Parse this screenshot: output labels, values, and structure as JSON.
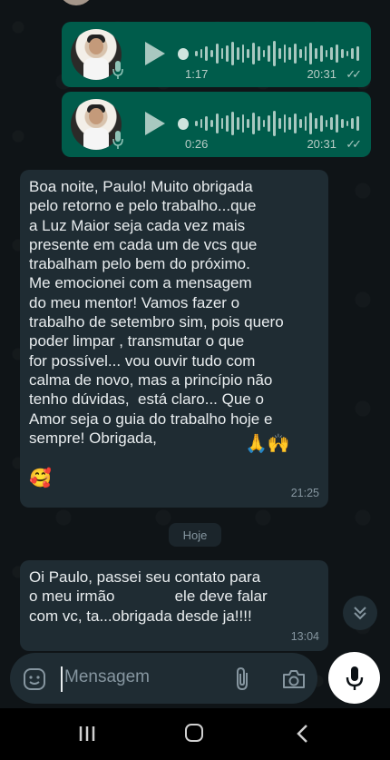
{
  "voice_messages": [
    {
      "duration": "1:17",
      "time": "20:31"
    },
    {
      "duration": "0:26",
      "time": "20:31"
    }
  ],
  "incoming_1": {
    "lines": [
      "Boa noite, Paulo! Muito obrigada",
      "pelo retorno e pelo trabalho...que",
      "a Luz Maior seja cada vez mais",
      "presente em cada um de vcs que",
      "trabalham pelo bem do próximo.",
      "Me emocionei com a mensagem",
      "do meu mentor! Vamos fazer o",
      "trabalho de setembro sim, pois quero",
      "poder limpar , transmutar o que",
      "for possível... vou ouvir tudo com",
      "calma de novo, mas a princípio não",
      "tenho dúvidas,  está claro... Que o",
      "Amor seja o guia do trabalho hoje e",
      "sempre! Obrigada,"
    ],
    "emojis_inline": "🙏🙌",
    "emoji_last": "🥰",
    "time": "21:25"
  },
  "date_chip": "Hoje",
  "incoming_2": {
    "lines": [
      "Oi Paulo, passei seu contato para",
      "o meu irmão              ele deve falar",
      "com vc, ta...obrigada desde ja!!!!"
    ],
    "time": "13:04"
  },
  "composer": {
    "placeholder": "Mensagem"
  },
  "icons": {
    "emoji": "emoji-icon",
    "attach": "paperclip-icon",
    "camera": "camera-icon",
    "mic": "microphone-icon",
    "scroll": "chevron-double-down-icon"
  },
  "colors": {
    "outgoing": "#005c4b",
    "incoming": "#1f2c33",
    "background": "#0f1417"
  }
}
